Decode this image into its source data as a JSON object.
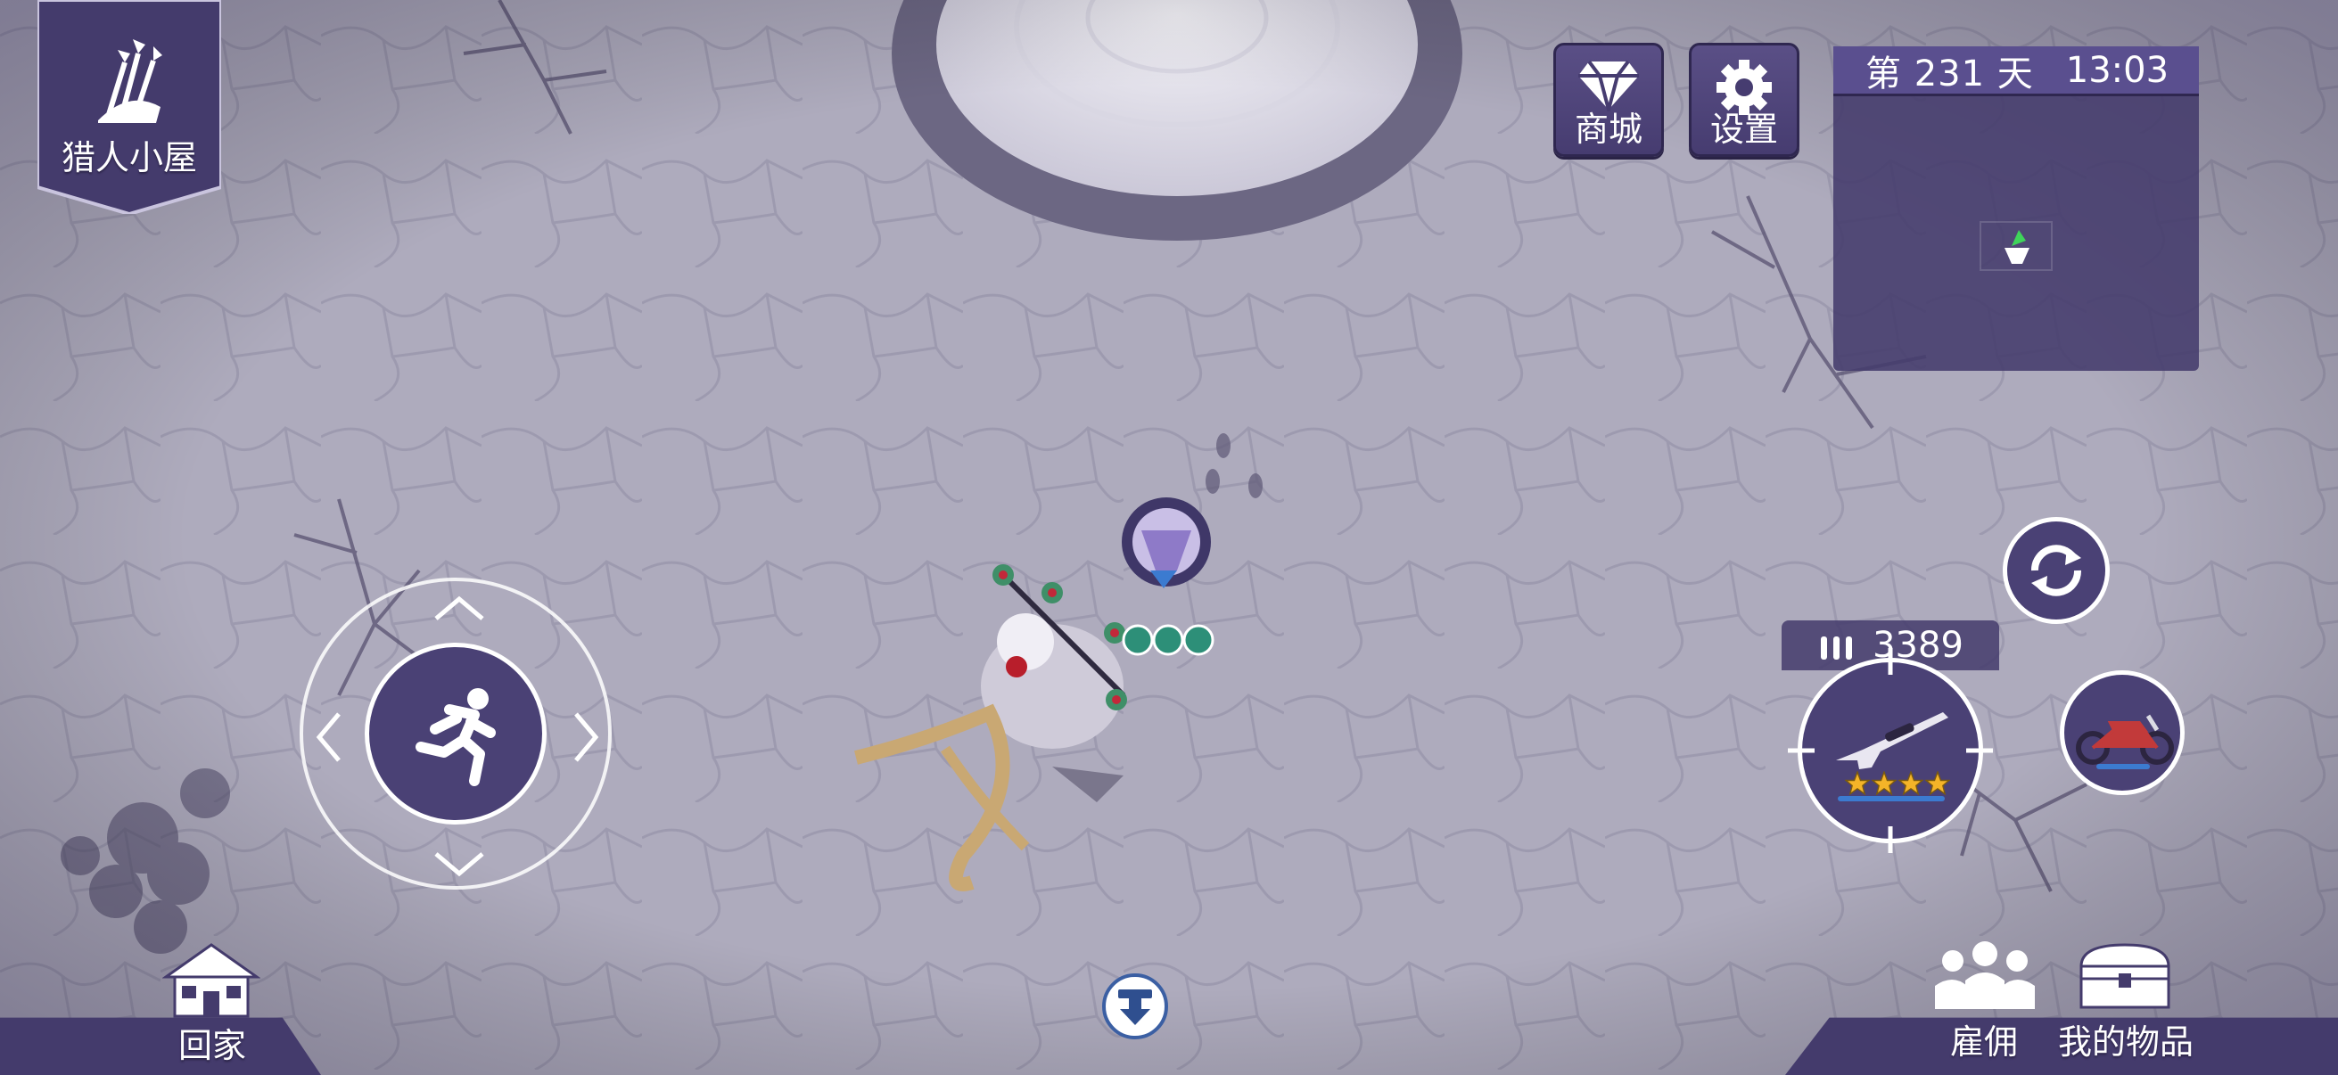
{
  "location": {
    "title": "猎人小屋",
    "icon": "arrows-quiver-icon"
  },
  "top_buttons": [
    {
      "id": "shop",
      "label": "商城",
      "icon": "diamond-icon"
    },
    {
      "id": "settings",
      "label": "设置",
      "icon": "gear-icon"
    }
  ],
  "minimap": {
    "day_label": "第 231 天",
    "time": "13:03"
  },
  "ammo": {
    "count": "3389",
    "icon": "bullets-icon"
  },
  "weapon": {
    "name_icon": "sniper-rifle-icon",
    "stars": 4
  },
  "vehicle": {
    "icon": "motorcycle-icon"
  },
  "bottom": {
    "home_label": "回家",
    "hire_label": "雇佣",
    "inventory_label": "我的物品"
  },
  "colors": {
    "panel": "#443b6c",
    "panel_dark": "#2f2750",
    "ground": "#a9a6b8",
    "star": "#f4b428"
  }
}
